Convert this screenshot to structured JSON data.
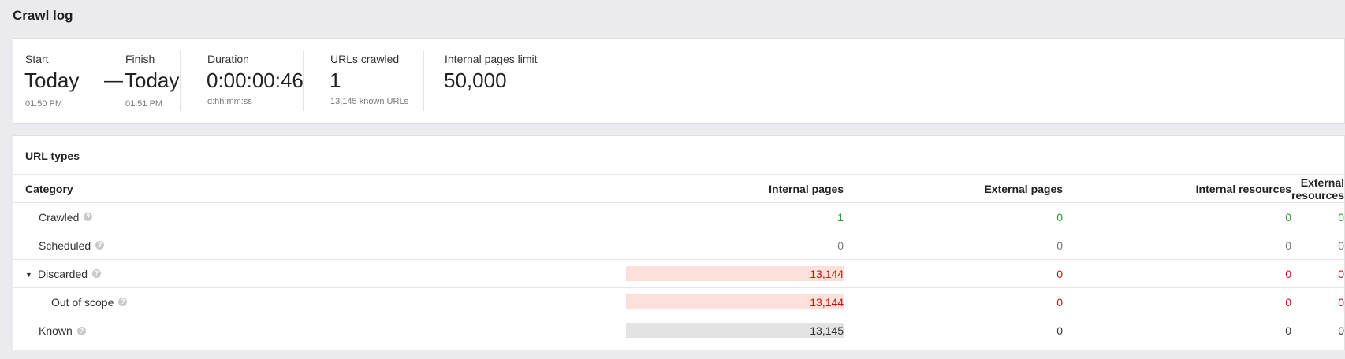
{
  "page": {
    "title": "Crawl log"
  },
  "summary": {
    "start": {
      "label": "Start",
      "value": "Today",
      "time": "01:50 PM"
    },
    "separator": "—",
    "finish": {
      "label": "Finish",
      "value": "Today",
      "time": "01:51 PM"
    },
    "duration": {
      "label": "Duration",
      "value": "0:00:00:46",
      "format": "d:hh:mm:ss"
    },
    "urls_crawled": {
      "label": "URLs crawled",
      "value": "1",
      "known": "13,145 known URLs"
    },
    "pages_limit": {
      "label": "Internal pages limit",
      "value": "50,000"
    }
  },
  "url_types": {
    "title": "URL types",
    "columns": [
      "Category",
      "Internal pages",
      "External pages",
      "Internal resources",
      "External resources"
    ],
    "rows": [
      {
        "name": "Crawled",
        "values": [
          "1",
          "0",
          "0",
          "0"
        ]
      },
      {
        "name": "Scheduled",
        "values": [
          "0",
          "0",
          "0",
          "0"
        ]
      },
      {
        "name": "Discarded",
        "values": [
          "13,144",
          "0",
          "0",
          "0"
        ]
      },
      {
        "name": "Out of scope",
        "values": [
          "13,144",
          "0",
          "0",
          "0"
        ]
      },
      {
        "name": "Known",
        "values": [
          "13,145",
          "0",
          "0",
          "0"
        ]
      }
    ],
    "help_glyph": "?",
    "expand_glyph": "▼"
  },
  "colors": {
    "crawled": "#2d9a2d",
    "scheduled": "#777777",
    "discarded": "#cc1111",
    "known": "#333333",
    "discarded_bar": "#fde0d9",
    "known_bar": "#e3e3e3"
  }
}
